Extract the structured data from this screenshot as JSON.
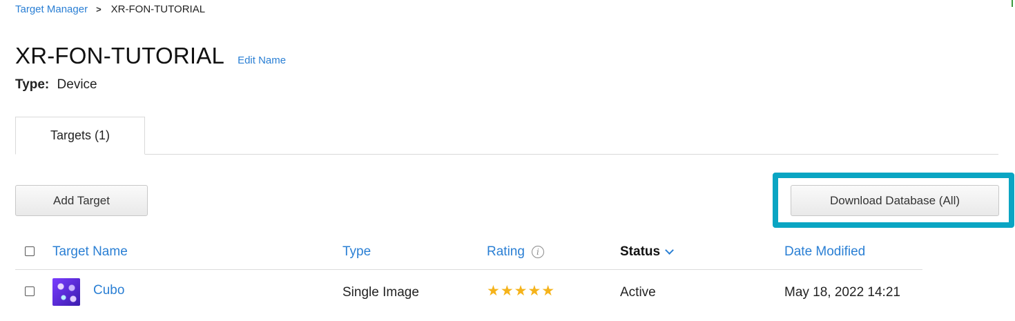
{
  "breadcrumb": {
    "root": "Target Manager",
    "separator": ">",
    "current": "XR-FON-TUTORIAL"
  },
  "header": {
    "title": "XR-FON-TUTORIAL",
    "edit_label": "Edit Name",
    "type_label": "Type:",
    "type_value": "Device"
  },
  "tabs": [
    {
      "label": "Targets (1)",
      "active": true
    }
  ],
  "actions": {
    "add_target": "Add Target",
    "download_database": "Download Database (All)"
  },
  "table": {
    "columns": {
      "name": "Target Name",
      "type": "Type",
      "rating": "Rating",
      "status": "Status",
      "date": "Date Modified"
    },
    "sorted_by": "status",
    "rows": [
      {
        "name": "Cubo",
        "type": "Single Image",
        "rating": 5,
        "rating_stars": "★★★★★",
        "status": "Active",
        "date": "May 18, 2022 14:21"
      }
    ]
  },
  "colors": {
    "link": "#2a7fd4",
    "highlight": "#0aa5c3",
    "star": "#f5b31b"
  }
}
